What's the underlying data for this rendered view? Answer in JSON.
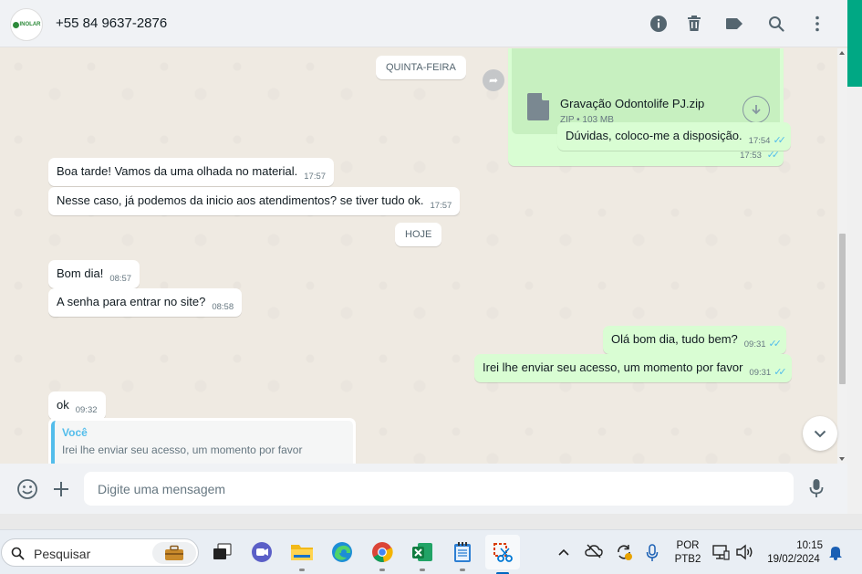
{
  "header": {
    "avatar_text": "INOLAR",
    "contact": "+55 84 9637-2876",
    "icons": [
      "info-icon",
      "trash-icon",
      "label-icon",
      "search-icon",
      "menu-icon"
    ]
  },
  "chat": {
    "day_thursday": "QUINTA-FEIRA",
    "day_today": "HOJE",
    "file": {
      "name": "Gravação Odontolife PJ.zip",
      "meta": "ZIP • 103 MB",
      "time": "17:53"
    },
    "messages": [
      {
        "text": "Dúvidas, coloco-me a disposição.",
        "time": "17:54"
      },
      {
        "text": "Boa tarde! Vamos da uma olhada no material.",
        "time": "17:57"
      },
      {
        "text": "Nesse caso, já podemos da inicio aos atendimentos? se tiver tudo ok.",
        "time": "17:57"
      },
      {
        "text": "Bom dia!",
        "time": "08:57"
      },
      {
        "text": "A senha para entrar no site?",
        "time": "08:58"
      },
      {
        "text": "Olá bom dia, tudo bem?",
        "time": "09:31"
      },
      {
        "text": "Irei lhe enviar seu acesso, um momento por favor",
        "time": "09:31"
      },
      {
        "text": "ok",
        "time": "09:32"
      }
    ],
    "quote": {
      "author": "Você",
      "text": "Irei lhe enviar seu acesso, um momento por favor"
    }
  },
  "composer": {
    "placeholder": "Digite uma mensagem"
  },
  "taskbar": {
    "search_placeholder": "Pesquisar",
    "lang_top": "POR",
    "lang_bottom": "PTB2",
    "time": "10:15",
    "date": "19/02/2024"
  },
  "colors": {
    "outgoing_bubble": "#d9fdd3",
    "incoming_bubble": "#ffffff",
    "chat_background": "#efeae2",
    "read_ticks": "#53bdeb",
    "accent": "#00a884"
  }
}
